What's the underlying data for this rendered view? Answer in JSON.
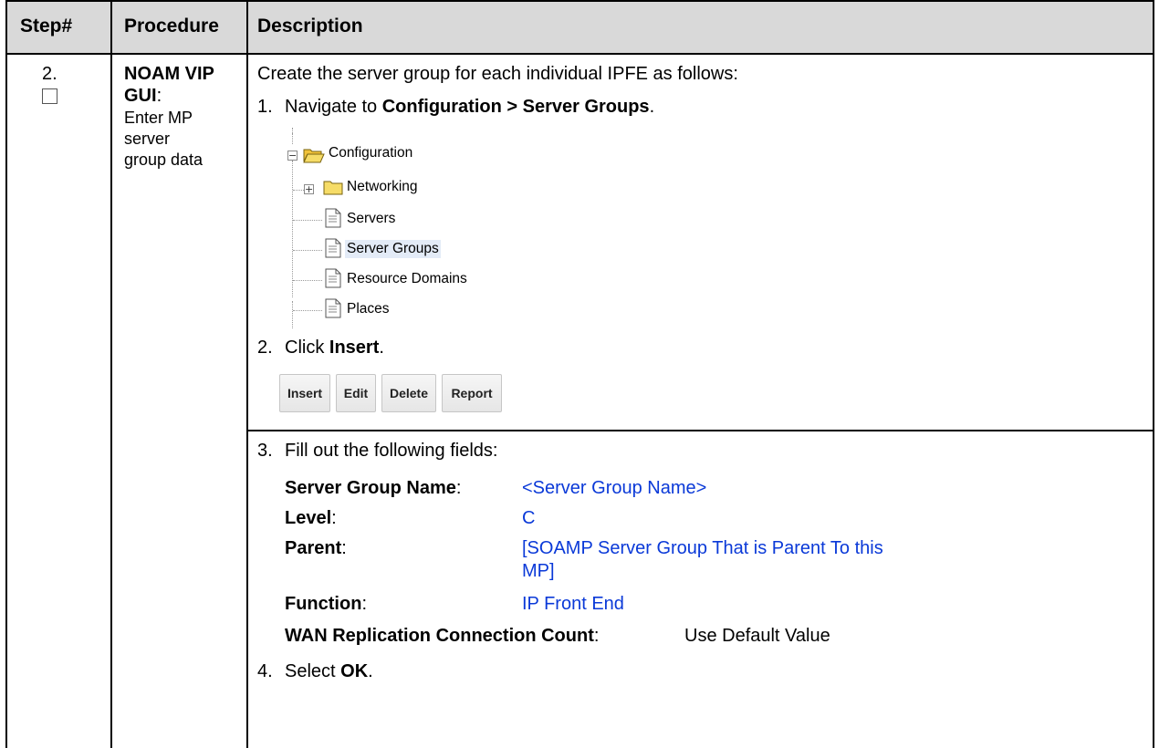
{
  "header": {
    "step": "Step#",
    "procedure": "Procedure",
    "description": "Description"
  },
  "row": {
    "step_number": "2.",
    "procedure_title": "NOAM VIP GUI",
    "procedure_colon": ":",
    "procedure_sub": [
      "Enter MP",
      "server",
      "group data"
    ],
    "intro": "Create the server group for each individual IPFE as follows:",
    "step1": {
      "num": "1.",
      "prefix": "Navigate to ",
      "bold": "Configuration > Server Groups",
      "suffix": "."
    },
    "tree": {
      "root": "Configuration",
      "items": [
        "Networking",
        "Servers",
        "Server Groups",
        "Resource Domains",
        "Places"
      ],
      "selected": "Server Groups"
    },
    "step2": {
      "num": "2.",
      "prefix": "Click ",
      "bold": "Insert",
      "suffix": "."
    },
    "buttons": [
      "Insert",
      "Edit",
      "Delete",
      "Report"
    ],
    "step3": {
      "num": "3.",
      "text": "Fill out the following fields:"
    },
    "fields": [
      {
        "label": "Server Group Name",
        "colon": ":",
        "value": "<Server Group Name>"
      },
      {
        "label": "Level",
        "colon": ":",
        "value": "C"
      },
      {
        "label": "Parent",
        "colon": ":",
        "value_line1": "[SOAMP Server Group That is Parent To this",
        "value_line2": "MP]"
      },
      {
        "label": "Function",
        "colon": ":",
        "value": "IP Front End"
      },
      {
        "label": "WAN Replication Connection Count",
        "colon": ":",
        "value": "Use Default Value"
      }
    ],
    "step4": {
      "num": "4.",
      "prefix": "Select ",
      "bold": "OK",
      "suffix": "."
    }
  },
  "colors": {
    "header_bg": "#d9d9d9",
    "value_blue": "#0a39d8",
    "selected_node_bg": "#e3ebf7",
    "folder_yellow": "#f3d64e"
  }
}
